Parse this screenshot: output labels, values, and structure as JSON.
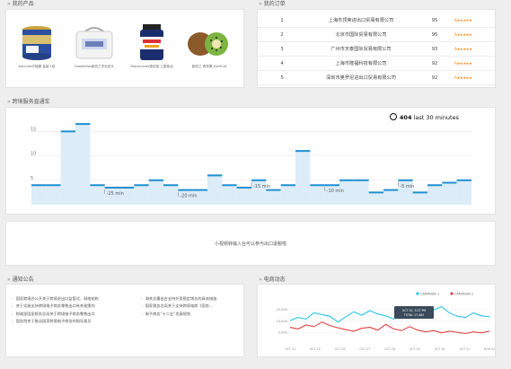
{
  "sections": {
    "products_title": "我的产品",
    "orders_title": "我的订单",
    "bus_title": "跨境服务直通车",
    "notice_title": "通知公告",
    "ecom_title": "电商动态"
  },
  "products": [
    {
      "caption": "Karicare可瑞康 金装 1段"
    },
    {
      "caption": "Goodfellas新西兰羊毛枕头"
    },
    {
      "caption": "Blackmores澳佳宝 儿童鱼油"
    },
    {
      "caption": "新西兰 奇异果 Kiwifruit"
    }
  ],
  "orders": [
    {
      "no": "1",
      "company": "上海市顶荣进出口贸易有限公司",
      "score": "95",
      "rating": "A",
      "stars": 5
    },
    {
      "no": "2",
      "company": "北京市国际贸易有限公司",
      "score": "95",
      "rating": "A",
      "stars": 5
    },
    {
      "no": "3",
      "company": "广州市天泰国际贸易有限公司",
      "score": "93",
      "rating": "A",
      "stars": 5
    },
    {
      "no": "4",
      "company": "上海市隆福科技有限公司",
      "score": "92",
      "rating": "A",
      "stars": 5
    },
    {
      "no": "5",
      "company": "深圳市奥罗尼进出口贸易有限公司",
      "score": "92",
      "rating": "A",
      "stars": 5
    }
  ],
  "bus": {
    "icon": "stopwatch-icon",
    "count": "404",
    "suffix": " last 30 minutes"
  },
  "chart_data": [
    {
      "type": "area",
      "title": "",
      "y_ticks": [
        5,
        10,
        15
      ],
      "ylim": [
        0,
        18
      ],
      "x_tick_labels": [
        "-25 min",
        "-20 min",
        "-15 min",
        "-10 min",
        "-5 min"
      ],
      "x": [
        -30,
        -29,
        -28,
        -27,
        -26,
        -25,
        -24,
        -23,
        -22,
        -21,
        -20,
        -19,
        -18,
        -17,
        -16,
        -15,
        -14,
        -13,
        -12,
        -11,
        -10,
        -9,
        -8,
        -7,
        -6,
        -5,
        -4,
        -3,
        -2,
        -1
      ],
      "values": [
        4,
        4,
        15,
        16.5,
        4,
        3.5,
        3.5,
        4,
        5,
        4,
        3,
        3,
        6,
        4,
        3.5,
        5,
        3,
        4,
        11,
        4,
        4,
        5,
        5,
        2.5,
        3,
        5,
        2.5,
        4,
        4.5,
        5
      ],
      "color": "#1f8fd0",
      "fill": "#dcecf8"
    },
    {
      "type": "line",
      "title": "",
      "legend": [
        "CAMPAIGN 1",
        "CAMPAIGN 2"
      ],
      "legend_colors": [
        "#29c4e6",
        "#e04040"
      ],
      "y_ticks": [
        "5,000",
        "10,000",
        "15,000"
      ],
      "ylim": [
        0,
        18000
      ],
      "x_tick_labels": [
        "OCT 24",
        "OCT 25",
        "OCT 26",
        "OCT 27",
        "OCT 28",
        "OCT 29",
        "OCT 30",
        "OCT 31",
        "NOV 01"
      ],
      "series": [
        {
          "name": "CAMPAIGN 1",
          "values": [
            10200,
            11500,
            10800,
            13500,
            12800,
            12000,
            9500,
            11800,
            14000,
            12500,
            14500,
            13000,
            12200,
            10800,
            13800,
            11500,
            12800,
            15200,
            14800,
            16200,
            13500,
            12000,
            11500,
            13500,
            12200,
            11800
          ]
        },
        {
          "name": "CAMPAIGN 2",
          "values": [
            7200,
            6500,
            8200,
            7500,
            9500,
            8000,
            7000,
            6200,
            5500,
            6800,
            7200,
            6000,
            8500,
            6500,
            5800,
            7500,
            6000,
            5200,
            5800,
            4800,
            5500,
            5000,
            4500,
            5200,
            4800,
            5500
          ]
        }
      ],
      "tooltip": [
        "OCT 30, 3:27 PM",
        "TOTAL 17,482"
      ]
    }
  ],
  "ad": {
    "text": "小视频转输入台可以参与出口退税啦"
  },
  "notices": {
    "left": [
      "国家跨境办公开关于跨境进出口监管试、网络结构",
      "关于实施支持跨境电子商务零售出口有关政策的",
      "财政部国家税务总局关于跨境电子商务零售出口",
      "国务院关于推动国家跨境电子商务的指导意见"
    ],
    "right": [
      "海关总署出台支持外贸稳定增长的具体措施",
      "国家税务总局关于支持跨境电商《国务...",
      "电子商务“十二五”发展规划"
    ]
  }
}
